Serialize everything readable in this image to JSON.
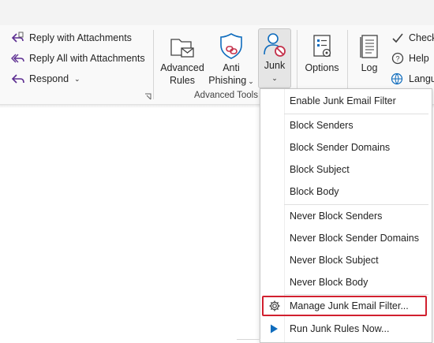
{
  "respond_group": {
    "reply_attachments": "Reply with Attachments",
    "reply_all_attachments": "Reply All with Attachments",
    "respond": "Respond"
  },
  "advanced_tools": {
    "advanced_rules": [
      "Advanced",
      "Rules"
    ],
    "anti_phishing": [
      "Anti",
      "Phishing"
    ],
    "junk": "Junk",
    "group_label": "Advanced Tools"
  },
  "options_label": "Options",
  "log_label": "Log",
  "right_group": {
    "check": "Check",
    "help": "Help",
    "language": "Langu"
  },
  "junk_menu": {
    "items": [
      "Enable Junk Email Filter",
      "Block Senders",
      "Block Sender Domains",
      "Block Subject",
      "Block Body",
      "Never Block Senders",
      "Never Block Sender Domains",
      "Never Block Subject",
      "Never Block Body",
      "Manage Junk Email Filter...",
      "Run Junk Rules Now..."
    ]
  },
  "colors": {
    "accent": "#0f6cbd",
    "highlight_border": "#d1202f",
    "blocked_red": "#c4314b"
  },
  "icons": {
    "reply_attachments": "reply-attachment-icon",
    "reply_all_attachments": "reply-all-attachment-icon",
    "respond": "respond-icon",
    "advanced_rules": "folder-envelope-icon",
    "anti_phishing": "shield-link-icon",
    "junk": "person-blocked-icon",
    "options": "options-gear-icon",
    "log": "log-document-icon",
    "check": "check-icon",
    "help": "help-icon",
    "language": "language-globe-icon",
    "manage": "gear-icon",
    "run": "play-icon"
  }
}
